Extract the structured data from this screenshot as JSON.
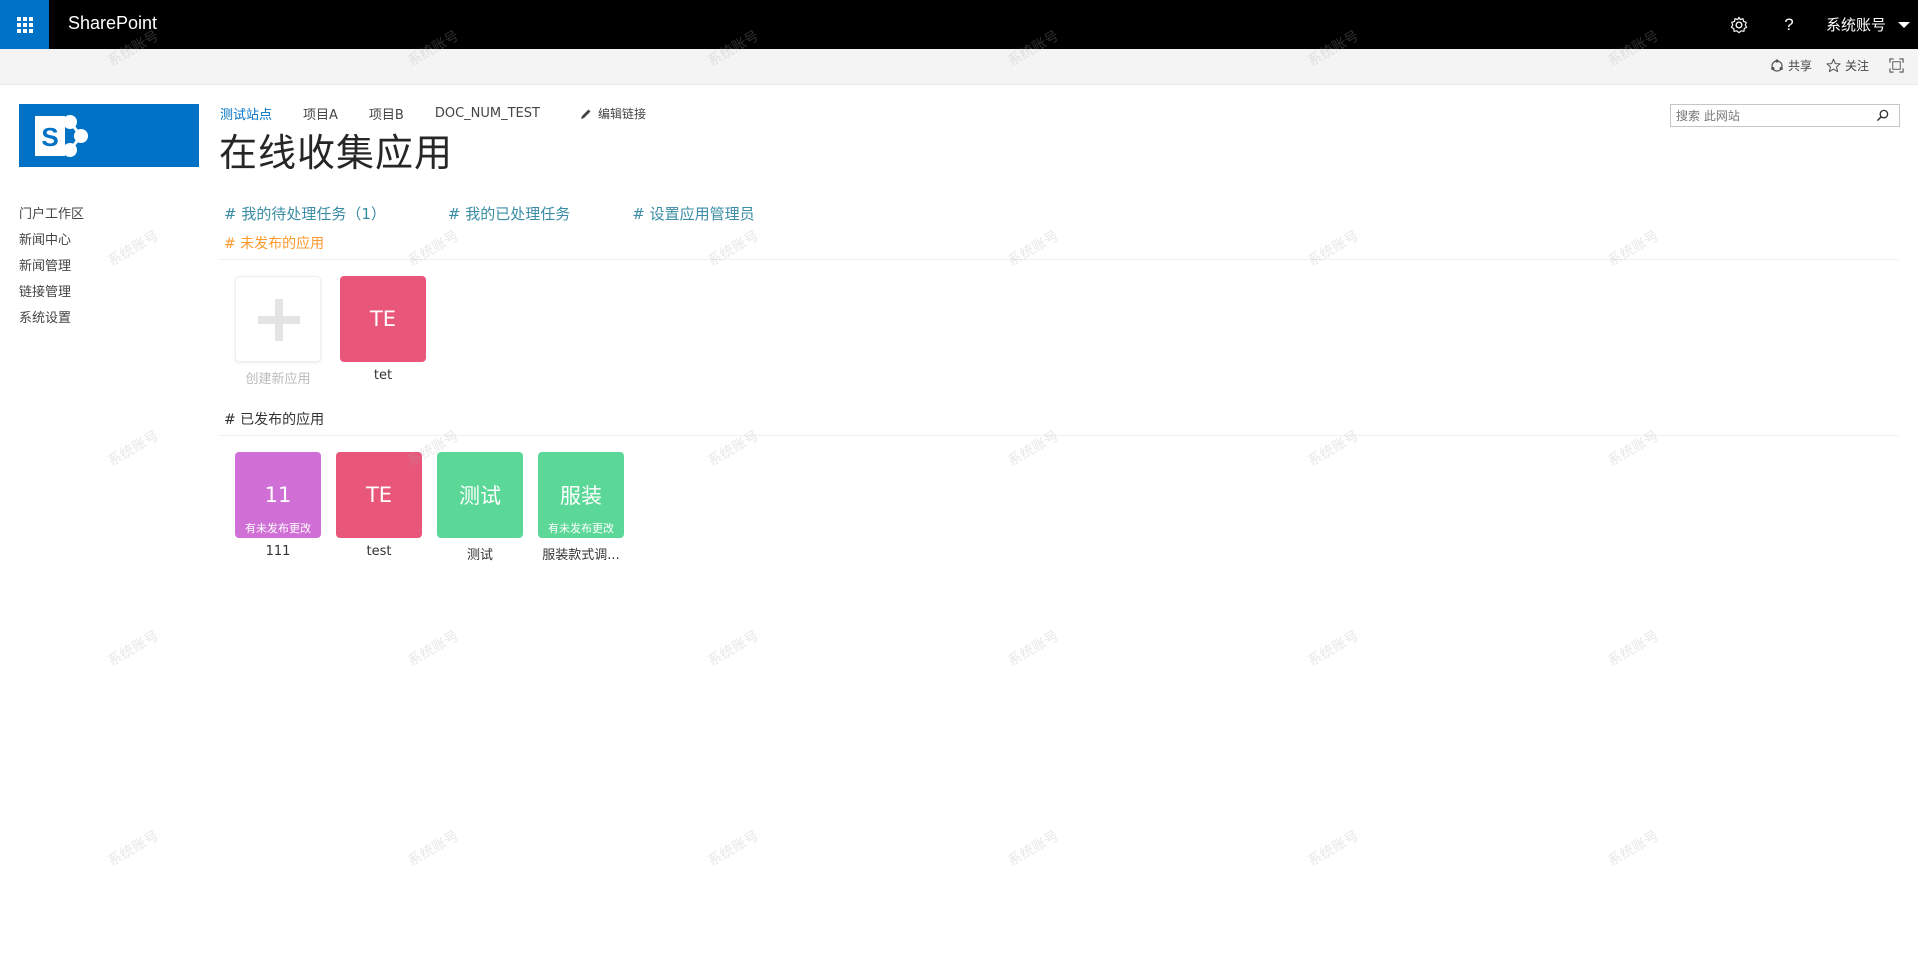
{
  "suite": {
    "brand": "SharePoint",
    "user_name": "系统账号",
    "icons": [
      "waffle-icon",
      "gear-icon",
      "help-icon",
      "chevron-down-icon"
    ],
    "help_glyph": "?"
  },
  "ribbon": {
    "share_label": "共享",
    "follow_label": "关注"
  },
  "topnav": {
    "items": [
      {
        "label": "测试站点",
        "selected": true
      },
      {
        "label": "项目A",
        "selected": false
      },
      {
        "label": "项目B",
        "selected": false
      },
      {
        "label": "DOC_NUM_TEST",
        "selected": false
      }
    ],
    "edit_links_label": "编辑链接"
  },
  "page_title": "在线收集应用",
  "search": {
    "placeholder": "搜索 此网站"
  },
  "leftnav": {
    "items": [
      "门户工作区",
      "新闻中心",
      "新闻管理",
      "链接管理",
      "系统设置"
    ]
  },
  "links": {
    "pending_tasks": "# 我的待处理任务（1）",
    "done_tasks": "# 我的已处理任务",
    "set_admin": "# 设置应用管理员"
  },
  "unpublished": {
    "heading": "# 未发布的应用",
    "new_app_label": "创建新应用",
    "apps": [
      {
        "abbr": "TE",
        "name": "tet",
        "color": "#e8577a"
      }
    ]
  },
  "published": {
    "heading": "# 已发布的应用",
    "apps": [
      {
        "abbr": "11",
        "name": "111",
        "color": "#d070d6",
        "badge": "有未发布更改"
      },
      {
        "abbr": "TE",
        "name": "test",
        "color": "#e8577a",
        "badge": ""
      },
      {
        "abbr": "测试",
        "name": "测试",
        "color": "#5bd897",
        "badge": ""
      },
      {
        "abbr": "服装",
        "name": "服装款式调...",
        "color": "#5bd897",
        "badge": "有未发布更改"
      }
    ]
  },
  "watermark_text": "系统账号",
  "colors": {
    "suite_bar": "#000000",
    "accent": "#0072c6",
    "link": "#3a8da5",
    "unpublished_heading": "#ff9a2e"
  }
}
